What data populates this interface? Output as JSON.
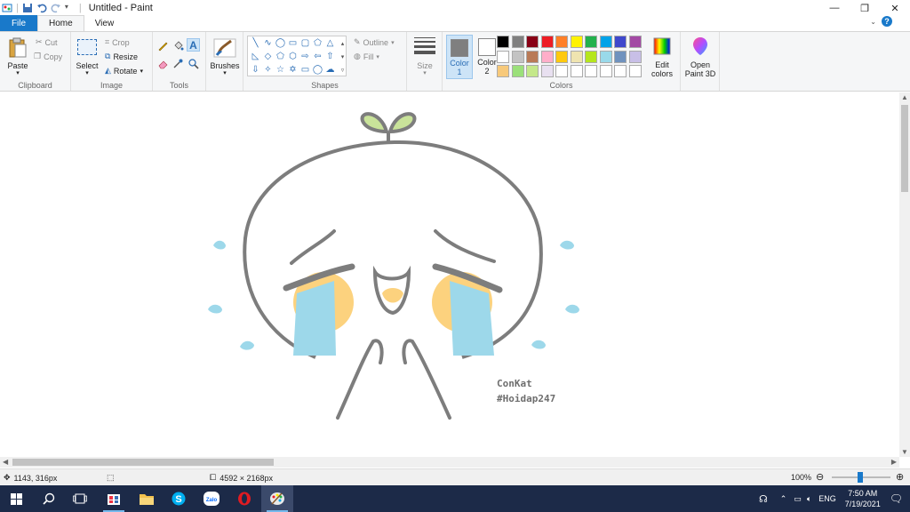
{
  "window": {
    "title": "Untitled - Paint"
  },
  "tabs": [
    {
      "label": "File"
    },
    {
      "label": "Home"
    },
    {
      "label": "View"
    }
  ],
  "clipboard": {
    "paste": "Paste",
    "cut": "Cut",
    "copy": "Copy",
    "group": "Clipboard"
  },
  "image": {
    "select": "Select",
    "crop": "Crop",
    "resize": "Resize",
    "rotate": "Rotate",
    "group": "Image"
  },
  "tools": {
    "group": "Tools"
  },
  "brushes": {
    "label": "Brushes"
  },
  "shapes": {
    "outline": "Outline",
    "fill": "Fill",
    "group": "Shapes"
  },
  "size": {
    "label": "Size"
  },
  "colors": {
    "color1": "Color\n1",
    "color2": "Color\n2",
    "color1_value": "#7f7f7f",
    "color2_value": "#ffffff",
    "edit": "Edit\ncolors",
    "group": "Colors",
    "palette_row1": [
      "#000000",
      "#7f7f7f",
      "#880015",
      "#ed1c24",
      "#ff7f27",
      "#fff200",
      "#22b14c",
      "#00a2e8",
      "#3f48cc",
      "#a349a4"
    ],
    "palette_row2": [
      "#ffffff",
      "#c3c3c3",
      "#b97a57",
      "#ffaec9",
      "#ffc90e",
      "#efe4b0",
      "#b5e61d",
      "#99d9ea",
      "#7092be",
      "#c8bfe7"
    ],
    "palette_row3": [
      "#f7c97a",
      "#9be07a",
      "#c4e88a",
      "#e8e0f0",
      "#ffffff",
      "#ffffff",
      "#ffffff",
      "#ffffff",
      "#ffffff",
      "#ffffff"
    ]
  },
  "paint3d": {
    "label": "Open\nPaint 3D"
  },
  "drawing": {
    "signature_line1": "ConKat",
    "signature_line2": "#Hoidap247"
  },
  "status": {
    "cursor": "1143, 316px",
    "image_size": "4592 × 2168px",
    "zoom": "100%"
  },
  "taskbar": {
    "lang": "ENG",
    "time": "7:50 AM",
    "date": "7/19/2021"
  }
}
